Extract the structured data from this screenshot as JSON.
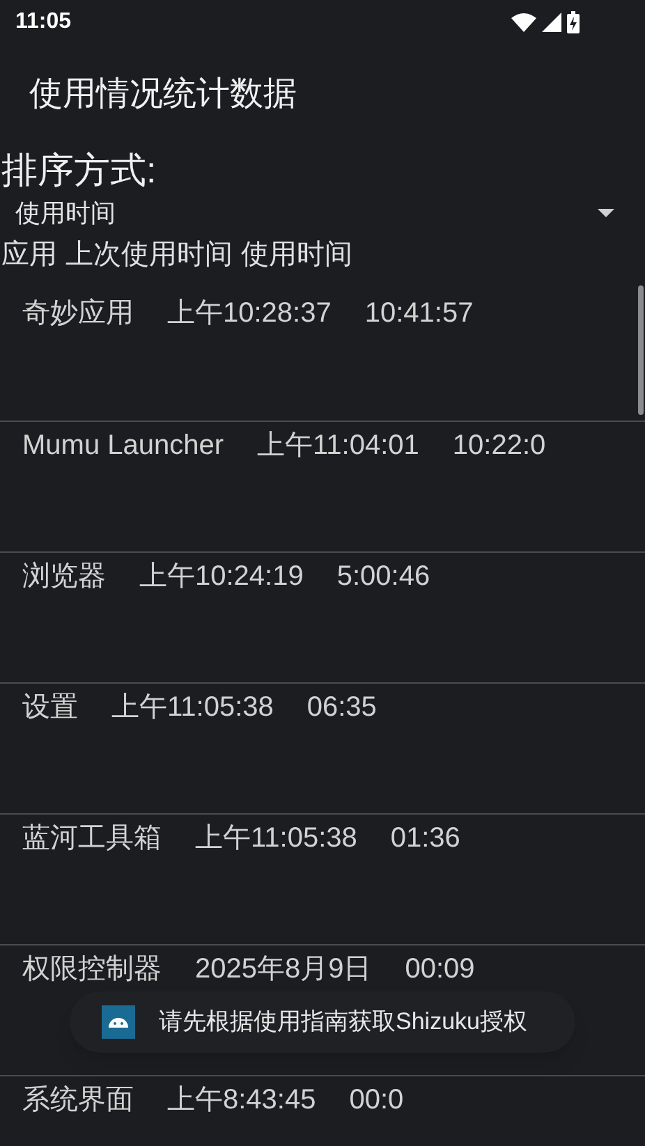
{
  "status_bar": {
    "time": "11:05"
  },
  "title": "使用情况统计数据",
  "sort": {
    "label": "排序方式:",
    "value": "使用时间"
  },
  "table": {
    "columns": [
      "应用",
      "上次使用时间",
      "使用时间"
    ],
    "rows": [
      {
        "app": "奇妙应用",
        "last_used": "上午10:28:37",
        "usage": "10:41:57"
      },
      {
        "app": "Mumu Launcher",
        "last_used": "上午11:04:01",
        "usage": "10:22:0"
      },
      {
        "app": "浏览器",
        "last_used": "上午10:24:19",
        "usage": "5:00:46"
      },
      {
        "app": "设置",
        "last_used": "上午11:05:38",
        "usage": "06:35"
      },
      {
        "app": "蓝河工具箱",
        "last_used": "上午11:05:38",
        "usage": "01:36"
      },
      {
        "app": "权限控制器",
        "last_used": "2025年8月9日",
        "usage": "00:09"
      },
      {
        "app": "系统界面",
        "last_used": "上午8:43:45",
        "usage": "00:0"
      }
    ]
  },
  "toast": {
    "text": "请先根据使用指南获取Shizuku授权"
  }
}
